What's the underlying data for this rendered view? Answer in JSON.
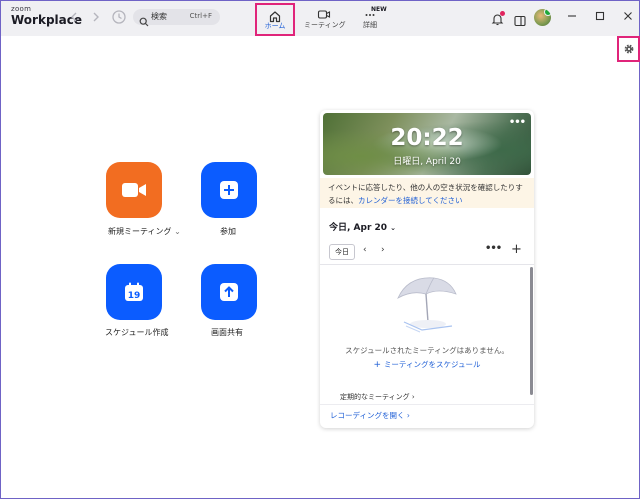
{
  "app": {
    "brand_small": "zoom",
    "brand_name": "Workplace"
  },
  "search": {
    "label": "検索",
    "shortcut": "Ctrl+F"
  },
  "tabs": {
    "home": "ホーム",
    "meetings": "ミーティング",
    "details": "詳細",
    "details_badge": "NEW"
  },
  "actions": {
    "new_meeting": "新規ミーティング",
    "new_meeting_chevron": "⌄",
    "join": "参加",
    "schedule": "スケジュール作成",
    "share_screen": "画面共有",
    "calendar_day": "19"
  },
  "calendar": {
    "time": "20:22",
    "date": "日曜日, April 20",
    "notice_line1": "イベントに応答したり、他の人の空き状況を確認したりす",
    "notice_line2_prefix": "るには、",
    "notice_link": "カレンダーを接続してください",
    "day_header": "今日, Apr 20",
    "today_button": "今日",
    "empty_message": "スケジュールされたミーティングはありません。",
    "schedule_link": "ミーティングをスケジュール",
    "recurring": "定期的なミーティング",
    "recordings": "レコーディングを開く"
  },
  "colors": {
    "accent": "#0b5cff",
    "new_meeting": "#f26d21",
    "highlight": "#e0247a",
    "notice_bg": "#fdf5e6"
  },
  "icons": [
    "back-arrow-icon",
    "forward-arrow-icon",
    "history-icon",
    "search-icon",
    "home-icon",
    "video-icon",
    "more-dots-icon",
    "bell-icon",
    "side-panel-icon",
    "avatar",
    "minimize-icon",
    "maximize-icon",
    "close-icon",
    "gear-icon",
    "camera-icon",
    "plus-icon",
    "calendar-icon",
    "share-arrow-icon",
    "umbrella-illustration"
  ]
}
